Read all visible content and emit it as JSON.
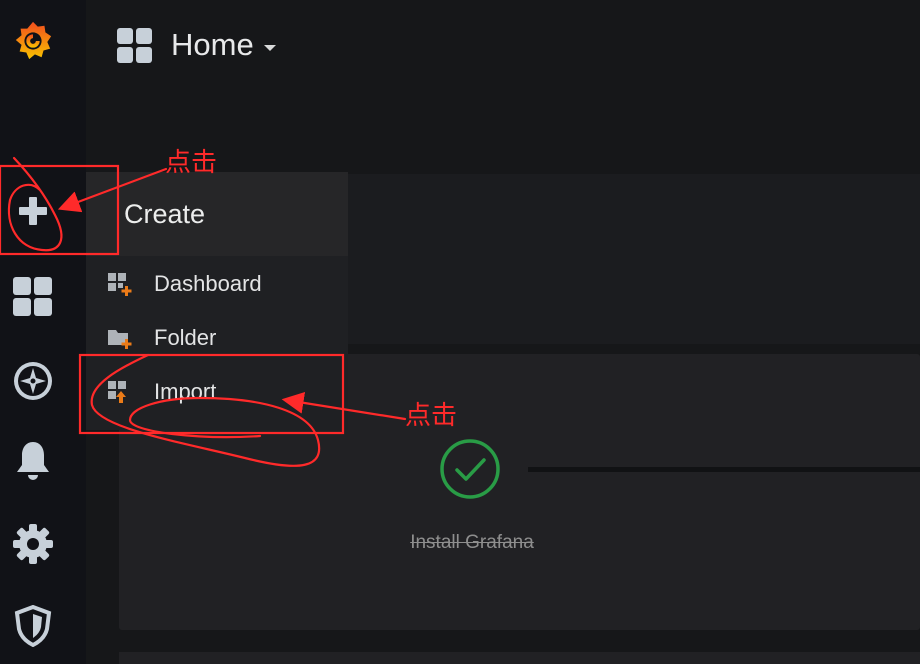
{
  "header": {
    "title": "Home"
  },
  "sidebar": {
    "items": [
      {
        "name": "grafana-logo",
        "icon": "grafana-logo-icon"
      },
      {
        "name": "create",
        "icon": "plus-icon"
      },
      {
        "name": "dashboards",
        "icon": "dashboard-grid-icon"
      },
      {
        "name": "explore",
        "icon": "compass-icon"
      },
      {
        "name": "alerting",
        "icon": "bell-icon"
      },
      {
        "name": "configuration",
        "icon": "gear-icon"
      },
      {
        "name": "server-admin",
        "icon": "shield-icon"
      }
    ]
  },
  "create_menu": {
    "title": "Create",
    "items": [
      {
        "label": "Dashboard",
        "icon": "dashboard-add-icon"
      },
      {
        "label": "Folder",
        "icon": "folder-add-icon"
      },
      {
        "label": "Import",
        "icon": "import-icon"
      }
    ]
  },
  "getting_started": {
    "step_label": "Install Grafana",
    "step_icon": "check-circle-icon"
  },
  "annotations": {
    "click_1": "点击",
    "click_2": "点击"
  },
  "colors": {
    "background": "#161719",
    "sidebar": "#111217",
    "menu": "#1f2023",
    "menu_header": "#262628",
    "panel": "#212124",
    "success_green": "#299c46",
    "annotation_red": "#ff2a2a",
    "grafana_orange": "#f46800"
  }
}
